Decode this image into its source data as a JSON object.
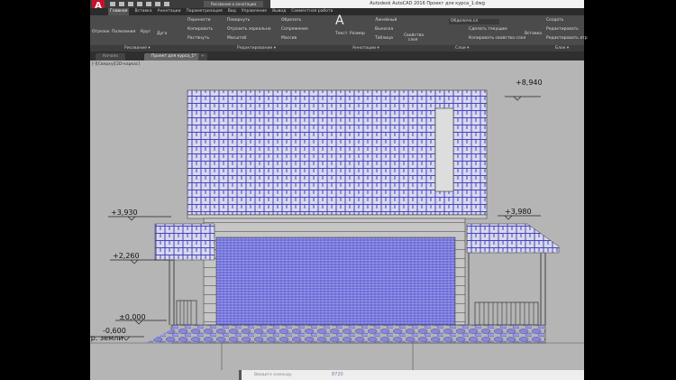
{
  "title": "Autodesk AutoCAD 2016    Проект для курса_1.dwg",
  "workspace": "Рисование и аннотации",
  "tabs": [
    "Главная",
    "Вставка",
    "Аннотации",
    "Параметризация",
    "Вид",
    "Управление",
    "Вывод",
    "Совместная работа"
  ],
  "ribbon": {
    "draw": [
      "Отрезок",
      "Полилиния",
      "Круг",
      "Дуга"
    ],
    "modify": [
      "Перенести",
      "Повернуть",
      "Копировать",
      "Отразить зеркально",
      "Растянуть",
      "Масштаб",
      "Обрезать",
      "Сопряжение",
      "Массив"
    ],
    "annot": [
      "Текст",
      "Размер",
      "Линейный",
      "Выноска",
      "Таблица"
    ],
    "layers": [
      "Свойства слоя",
      "Сделать текущим",
      "Копировать свойства слоя"
    ],
    "layer_current": "Обделочн.сл",
    "block": [
      "Вставка",
      "Создать",
      "Редактировать",
      "Редактировать атр"
    ]
  },
  "panels": [
    "Рисование ▾",
    "Редактирование ▾",
    "Аннотации ▾",
    "Слои ▾",
    "Блок ▾"
  ],
  "filetabs": [
    "Начало",
    "Проект для курса_1*",
    "+"
  ],
  "viewport": "[-][Сверху][2D-каркас]",
  "elevations": {
    "top": "+8,940",
    "left1": "+3,930",
    "right1": "+3,980",
    "left2": "+2,260",
    "zero": "±0,000",
    "ground": "-0,600",
    "ground_label": "ур. земли"
  },
  "command": {
    "placeholder": "Введите команду",
    "coord": "8720"
  },
  "colors": {
    "hatch": "#5555cc",
    "bg": "#b5b5b5",
    "logo": "#c8102e"
  }
}
